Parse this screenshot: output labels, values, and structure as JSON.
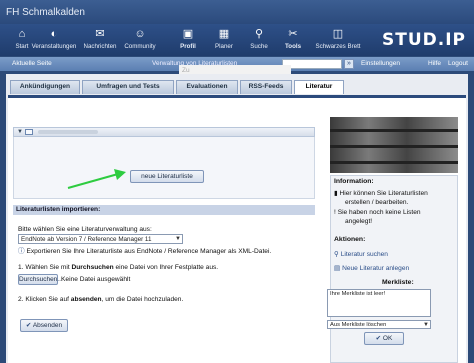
{
  "header": {
    "site": "FH Schmalkalden",
    "logo": "STUD.IP"
  },
  "nav": [
    {
      "label": "Start",
      "icon": "home-icon",
      "glyph": "⌂"
    },
    {
      "label": "Veranstaltungen",
      "icon": "courses-icon",
      "glyph": "◐"
    },
    {
      "label": "Nachrichten",
      "icon": "mail-icon",
      "glyph": "✉"
    },
    {
      "label": "Community",
      "icon": "community-icon",
      "glyph": "☺"
    },
    {
      "label": "Profil",
      "icon": "profile-icon",
      "glyph": "▣"
    },
    {
      "label": "Planer",
      "icon": "calendar-icon",
      "glyph": "▦"
    },
    {
      "label": "Suche",
      "icon": "search-icon",
      "glyph": "⚲"
    },
    {
      "label": "Tools",
      "icon": "tools-icon",
      "glyph": "✂"
    },
    {
      "label": "Schwarzes Brett",
      "icon": "board-icon",
      "glyph": "◫"
    }
  ],
  "subbar": {
    "current": "Aktuelle Seite",
    "breadcrumb": "Verwaltung von Literaturlisten",
    "settings": "Einstellungen",
    "help": "Hilfe",
    "logout": "Logout",
    "go": "»",
    "overlay": "Zu"
  },
  "tabs": [
    "Ankündigungen",
    "Umfragen und Tests",
    "Evaluationen",
    "RSS-Feeds",
    "Literatur"
  ],
  "main": {
    "new_list_button": "neue Literaturliste",
    "import_title": "Literaturlisten importieren:",
    "choose_label": "Bitte wählen Sie eine Literaturverwaltung aus:",
    "select_value": "EndNote ab Version 7 / Reference Manager 11",
    "hint": "Exportieren Sie Ihre Literaturliste aus EndNote / Reference Manager als XML-Datei.",
    "step1_a": "1. Wählen Sie mit ",
    "step1_b": "Durchsuchen",
    "step1_c": " eine Datei von Ihrer Festplatte aus.",
    "browse_button": "Durchsuchen...",
    "no_file": "Keine Datei ausgewählt",
    "step2_a": "2. Klicken Sie auf ",
    "step2_b": "absenden",
    "step2_c": ", um die Datei hochzuladen.",
    "submit_button": "Absenden"
  },
  "sidebar": {
    "info_title": "Information:",
    "info1a": "Hier können Sie Literaturlisten",
    "info1b": "erstellen / bearbeiten.",
    "info2a": "Sie haben noch keine Listen",
    "info2b": "angelegt!",
    "actions_title": "Aktionen:",
    "action1": "Literatur suchen",
    "action2": "Neue Literatur anlegen",
    "merk_title": "Merkliste:",
    "merk_text": "Ihre Merkliste ist leer!",
    "merk_select": "Aus Merkliste löschen",
    "ok_button": "OK"
  },
  "colors": {
    "accent": "#2b4a7c",
    "arrow": "#2ecc40"
  }
}
